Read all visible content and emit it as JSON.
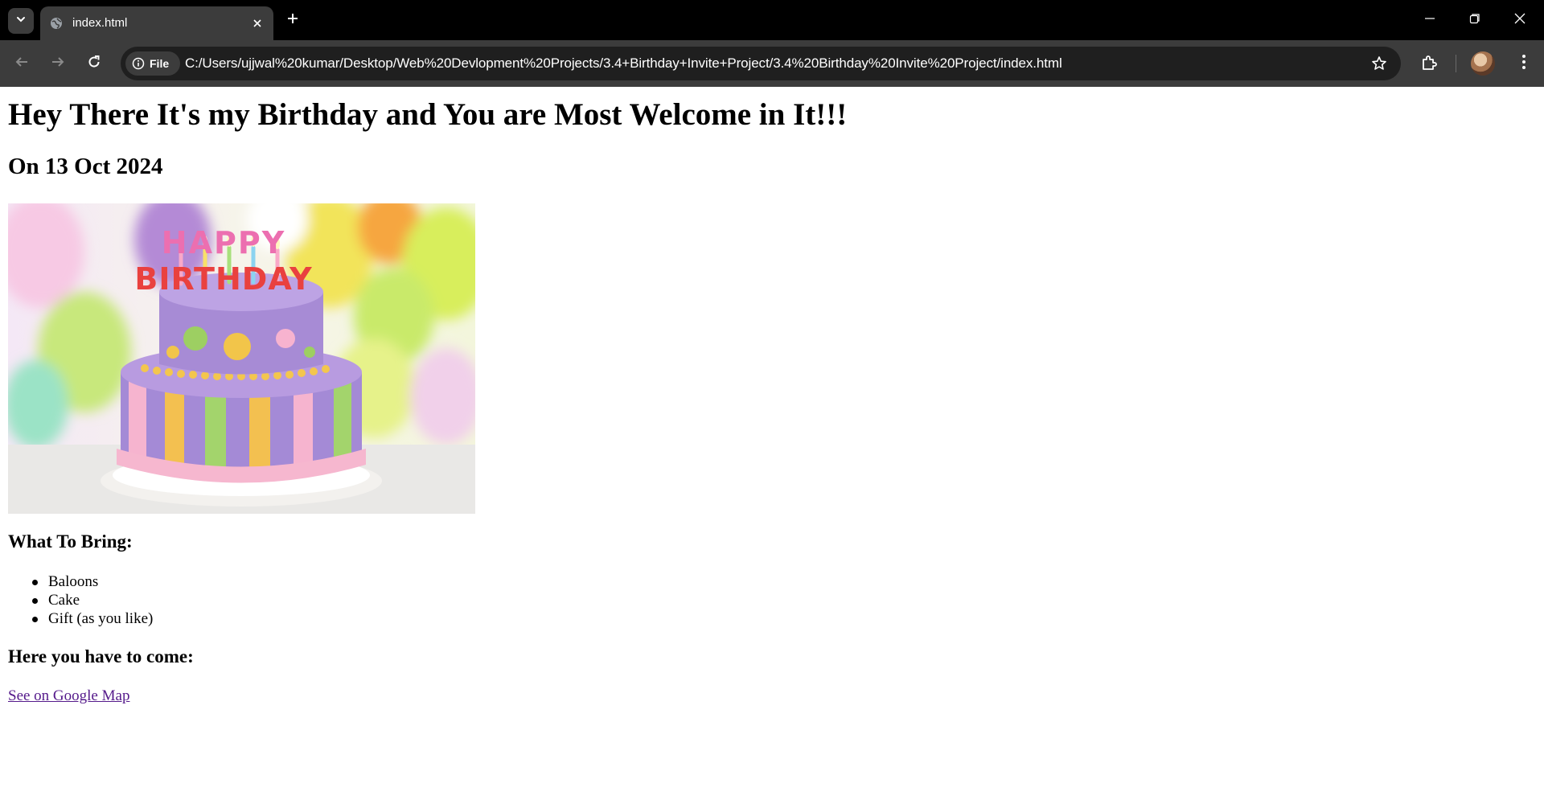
{
  "browser": {
    "tab_title": "index.html",
    "site_chip_label": "File",
    "url": "C:/Users/ujjwal%20kumar/Desktop/Web%20Devlopment%20Projects/3.4+Birthday+Invite+Project/3.4%20Birthday%20Invite%20Project/index.html",
    "icons": [
      "tab-search-icon",
      "globe-icon",
      "close-icon",
      "plus-icon",
      "minimize-icon",
      "restore-icon",
      "back-icon",
      "forward-icon",
      "reload-icon",
      "info-icon",
      "star-icon",
      "extensions-icon",
      "avatar",
      "more-vert-icon"
    ]
  },
  "page": {
    "heading": "Hey There It's my Birthday and You are Most Welcome in It!!!",
    "date_heading": "On 13 Oct 2024",
    "image_text": {
      "line1": "HAPPY",
      "line2": "BIRTHDAY"
    },
    "bring_heading": "What To Bring:",
    "bring_items": [
      "Baloons",
      "Cake",
      "Gift (as you like)"
    ],
    "location_heading": "Here you have to come:",
    "map_link": "See on Google Map"
  },
  "colors": {
    "visited_link": "#551a8b",
    "tabbar": "#000000",
    "toolbar": "#3c3c3c"
  }
}
